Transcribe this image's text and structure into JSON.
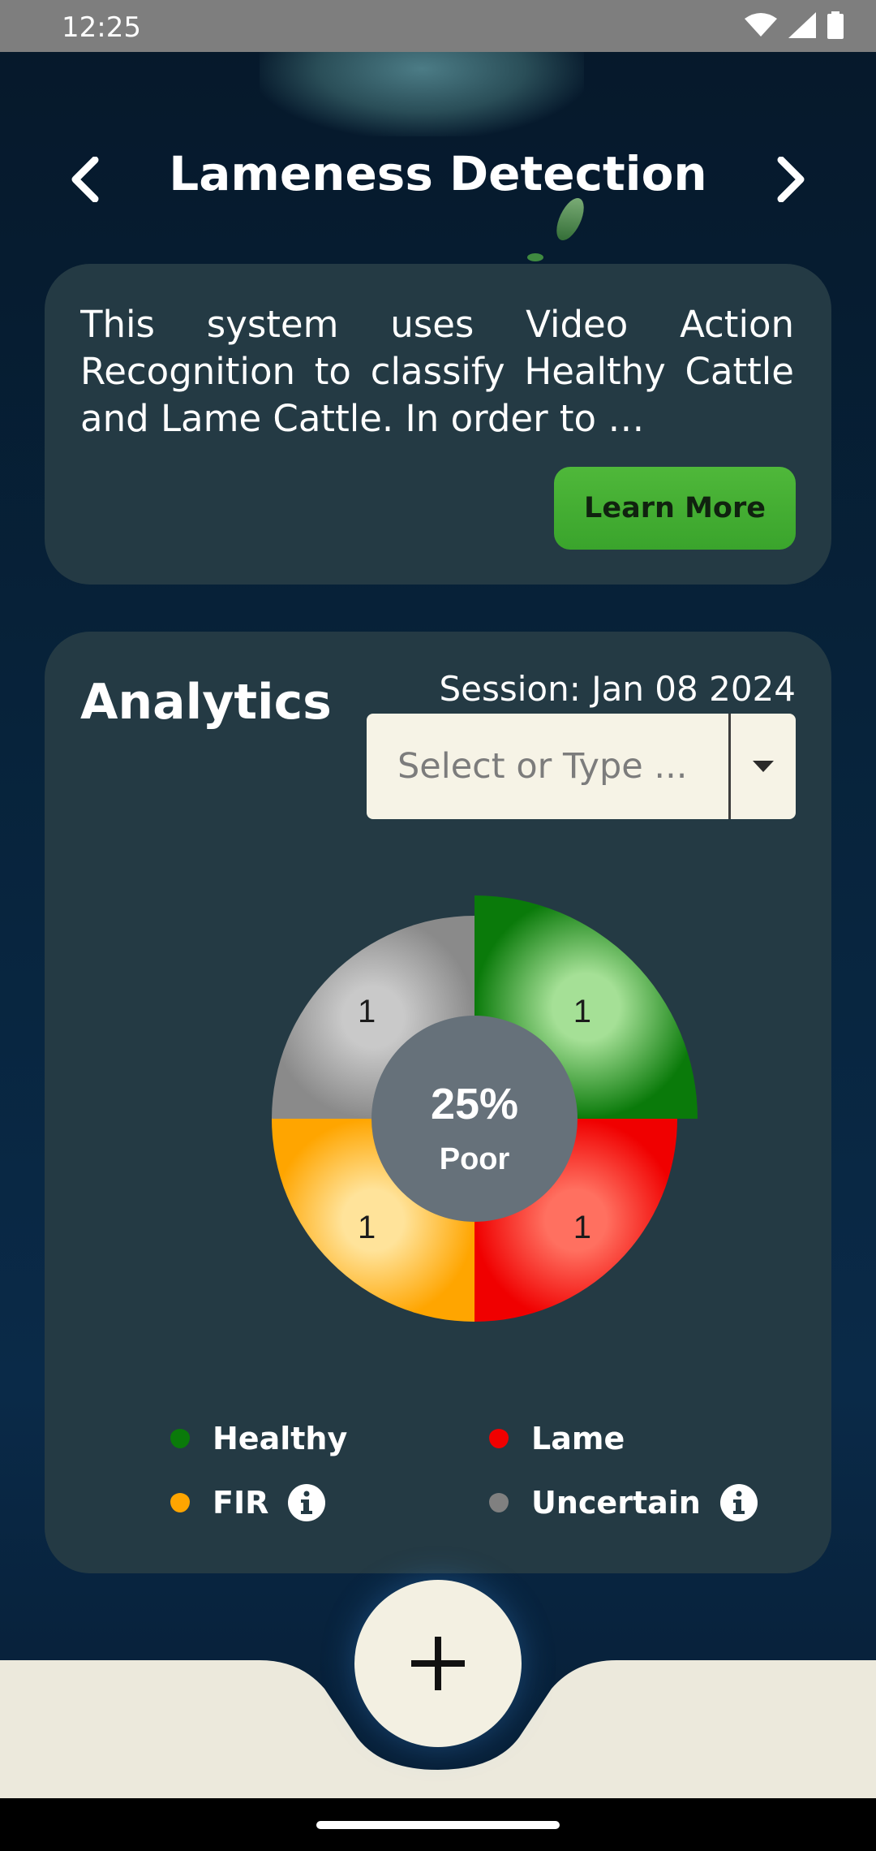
{
  "status_bar": {
    "time": "12:25",
    "icons": [
      "wifi-icon",
      "cellular-signal-icon",
      "battery-icon"
    ]
  },
  "header": {
    "title": "Lameness Detection",
    "prev_icon": "chevron-left-icon",
    "next_icon": "chevron-right-icon"
  },
  "intro_card": {
    "description": "This system uses Video Action Recognition to classify Healthy Cattle and Lame Cattle. In order to …",
    "learn_more_label": "Learn More",
    "learn_more_color": "#43ad30"
  },
  "analytics": {
    "title": "Analytics",
    "session_label": "Session: Jan 08 2024",
    "select": {
      "placeholder": "Select or Type ...",
      "icon": "caret-down-icon"
    },
    "center_percent": "25%",
    "center_status": "Poor",
    "legend": [
      {
        "label": "Healthy",
        "color": "#0a7a0a"
      },
      {
        "label": "Lame",
        "color": "#f00000"
      },
      {
        "label": "FIR",
        "color": "#ffa500",
        "info_icon": "info-icon"
      },
      {
        "label": "Uncertain",
        "color": "#808080",
        "info_icon": "info-icon"
      }
    ]
  },
  "chart_data": {
    "type": "pie",
    "categories": [
      "Healthy",
      "Lame",
      "FIR",
      "Uncertain"
    ],
    "values": [
      1,
      1,
      1,
      1
    ],
    "colors": [
      "#0a7a0a",
      "#f00000",
      "#ffa500",
      "#8a8a8a"
    ],
    "center_text": [
      "25%",
      "Poor"
    ],
    "highlighted": "Healthy"
  },
  "fab": {
    "icon": "plus-icon"
  }
}
